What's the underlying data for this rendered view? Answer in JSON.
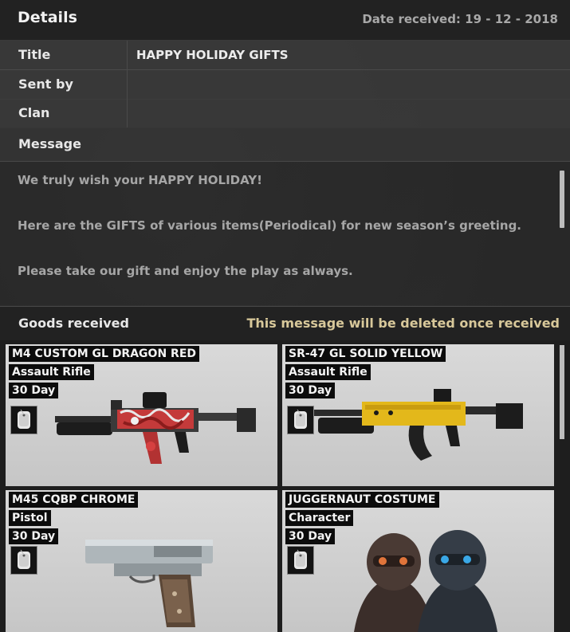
{
  "details": {
    "title": "Details",
    "date_label": "Date received: 19 - 12 - 2018"
  },
  "fields": [
    {
      "label": "Title",
      "value": "HAPPY HOLIDAY GIFTS"
    },
    {
      "label": "Sent by",
      "value": ""
    },
    {
      "label": "Clan",
      "value": ""
    }
  ],
  "message": {
    "label": "Message",
    "lines": [
      "We truly wish your HAPPY HOLIDAY!",
      "Here are the GIFTS of various items(Periodical) for new season’s greeting.",
      "Please take our gift and enjoy the play as always."
    ]
  },
  "goods": {
    "label": "Goods received",
    "notice": "This message will be deleted once received",
    "notice_color": "#d8c89a",
    "items": [
      {
        "name": "M4 CUSTOM GL DRAGON RED",
        "category": "Assault Rifle",
        "duration": "30 Day",
        "icon": "assault-rifle-red-icon"
      },
      {
        "name": "SR-47 GL SOLID YELLOW",
        "category": "Assault Rifle",
        "duration": "30 Day",
        "icon": "assault-rifle-yellow-icon"
      },
      {
        "name": "M45 CQBP CHROME",
        "category": "Pistol",
        "duration": "30 Day",
        "icon": "pistol-chrome-icon"
      },
      {
        "name": "JUGGERNAUT COSTUME",
        "category": "Character",
        "duration": "30 Day",
        "icon": "juggernaut-costume-icon"
      }
    ]
  }
}
